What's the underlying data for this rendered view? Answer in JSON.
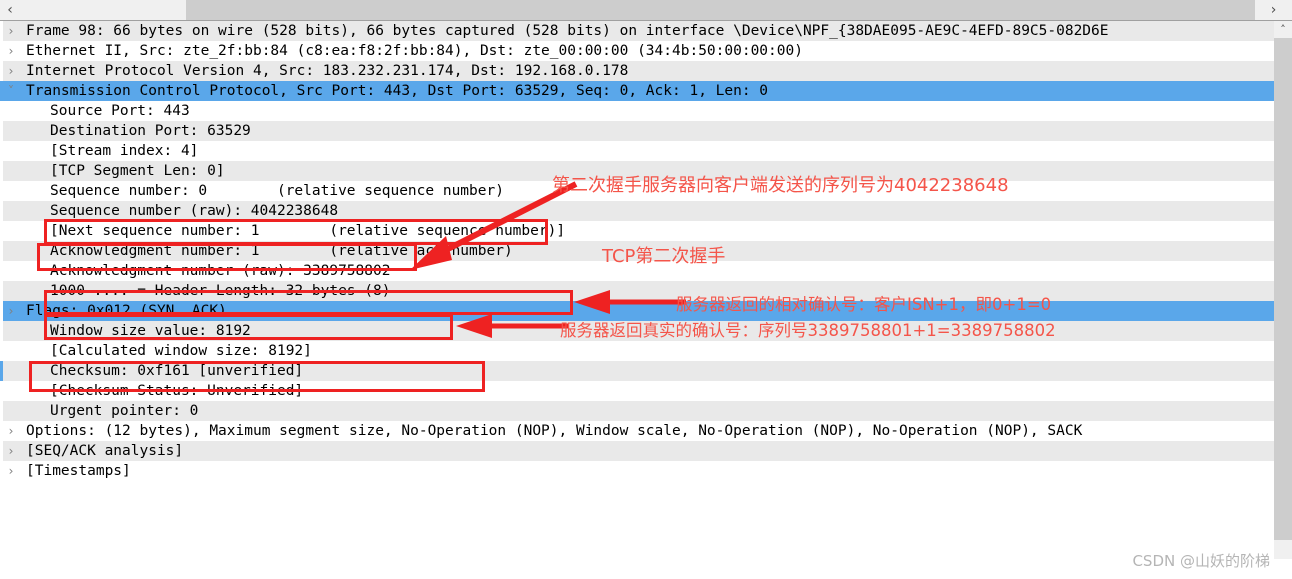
{
  "scrollbars": {
    "h_left_arrow": "‹",
    "h_right_arrow": "›",
    "v_up_arrow": "˄"
  },
  "tree": {
    "expand_glyph": "›",
    "collapse_glyph": "˅",
    "rows": [
      {
        "indent": 0,
        "twisty": "collapsed",
        "text": "Frame 98: 66 bytes on wire (528 bits), 66 bytes captured (528 bits) on interface \\Device\\NPF_{38DAE095-AE9C-4EFD-89C5-082D6E",
        "style": "alt"
      },
      {
        "indent": 0,
        "twisty": "collapsed",
        "text": "Ethernet II, Src: zte_2f:bb:84 (c8:ea:f8:2f:bb:84), Dst: zte_00:00:00 (34:4b:50:00:00:00)",
        "style": "plain"
      },
      {
        "indent": 0,
        "twisty": "collapsed",
        "text": "Internet Protocol Version 4, Src: 183.232.231.174, Dst: 192.168.0.178",
        "style": "alt"
      },
      {
        "indent": 0,
        "twisty": "expanded",
        "text": "Transmission Control Protocol, Src Port: 443, Dst Port: 63529, Seq: 0, Ack: 1, Len: 0",
        "style": "sel"
      },
      {
        "indent": 1,
        "twisty": "none",
        "text": "Source Port: 443",
        "style": "plain"
      },
      {
        "indent": 1,
        "twisty": "none",
        "text": "Destination Port: 63529",
        "style": "alt"
      },
      {
        "indent": 1,
        "twisty": "none",
        "text": "[Stream index: 4]",
        "style": "plain"
      },
      {
        "indent": 1,
        "twisty": "none",
        "text": "[TCP Segment Len: 0]",
        "style": "alt"
      },
      {
        "indent": 1,
        "twisty": "none",
        "text": "Sequence number: 0        (relative sequence number)",
        "style": "plain"
      },
      {
        "indent": 1,
        "twisty": "none",
        "text": "Sequence number (raw): 4042238648",
        "style": "alt"
      },
      {
        "indent": 1,
        "twisty": "none",
        "text": "[Next sequence number: 1        (relative sequence number)]",
        "style": "plain"
      },
      {
        "indent": 1,
        "twisty": "none",
        "text": "Acknowledgment number: 1        (relative ack number)",
        "style": "alt"
      },
      {
        "indent": 1,
        "twisty": "none",
        "text": "Acknowledgment number (raw): 3389758802",
        "style": "plain"
      },
      {
        "indent": 1,
        "twisty": "none",
        "text": "1000 .... = Header Length: 32 bytes (8)",
        "style": "alt"
      },
      {
        "indent": 0,
        "twisty": "collapsed",
        "text": "Flags: 0x012 (SYN, ACK)",
        "style": "sel"
      },
      {
        "indent": 1,
        "twisty": "none",
        "text": "Window size value: 8192",
        "style": "alt"
      },
      {
        "indent": 1,
        "twisty": "none",
        "text": "[Calculated window size: 8192]",
        "style": "plain"
      },
      {
        "indent": 1,
        "twisty": "none",
        "text": "Checksum: 0xf161 [unverified]",
        "style": "alt"
      },
      {
        "indent": 1,
        "twisty": "none",
        "text": "[Checksum Status: Unverified]",
        "style": "plain"
      },
      {
        "indent": 1,
        "twisty": "none",
        "text": "Urgent pointer: 0",
        "style": "alt"
      },
      {
        "indent": 0,
        "twisty": "collapsed",
        "text": "Options: (12 bytes), Maximum segment size, No-Operation (NOP), Window scale, No-Operation (NOP), No-Operation (NOP), SACK",
        "style": "plain"
      },
      {
        "indent": 0,
        "twisty": "collapsed",
        "text": "[SEQ/ACK analysis]",
        "style": "alt"
      },
      {
        "indent": 0,
        "twisty": "collapsed",
        "text": "[Timestamps]",
        "style": "plain"
      }
    ]
  },
  "annotations": {
    "color": "#f4554a",
    "box_color": "#ee2222",
    "notes": [
      {
        "id": "note-seq-raw",
        "text": "第二次握手服务器向客户端发送的序列号为4042238648"
      },
      {
        "id": "note-handshake-title",
        "text": "TCP第二次握手"
      },
      {
        "id": "note-rel-ack",
        "text": "服务器返回的相对确认号：客户ISN+1，即0+1=0"
      },
      {
        "id": "note-raw-ack",
        "text": "服务器返回真实的确认号：序列号3389758801+1=3389758802"
      }
    ]
  },
  "watermark": {
    "text": "CSDN @山妖的阶梯"
  }
}
